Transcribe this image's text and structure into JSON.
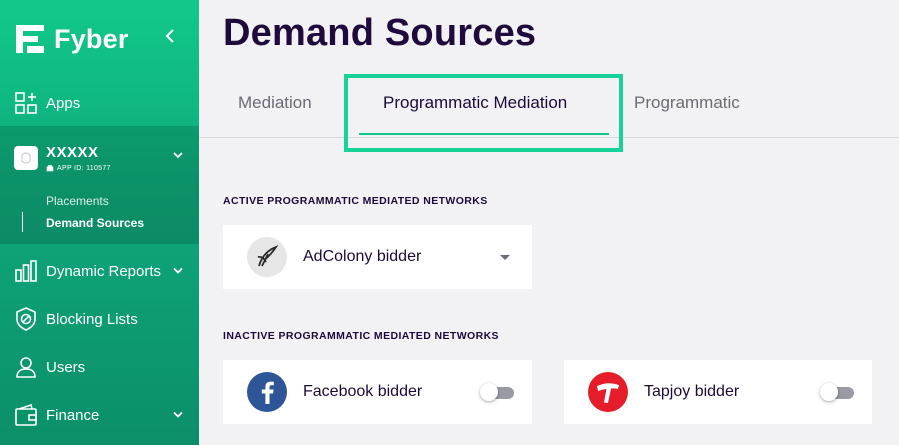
{
  "brand": {
    "name": "Fyber",
    "collapse_icon": "chevron-left-icon",
    "accent": "#10c98d",
    "sidebar_color": "#0fb37e"
  },
  "sidebar": {
    "apps_label": "Apps",
    "app": {
      "name": "XXXXX",
      "id_label": "APP ID: 110577",
      "platform_icon": "android-icon"
    },
    "sub_items": [
      {
        "label": "Placements",
        "active": false
      },
      {
        "label": "Demand Sources",
        "active": true
      }
    ],
    "items": [
      {
        "label": "Dynamic Reports",
        "icon": "bar-chart-icon",
        "has_chevron": true
      },
      {
        "label": "Blocking Lists",
        "icon": "shield-block-icon",
        "has_chevron": false
      },
      {
        "label": "Users",
        "icon": "user-icon",
        "has_chevron": false
      },
      {
        "label": "Finance",
        "icon": "wallet-icon",
        "has_chevron": true
      }
    ]
  },
  "page": {
    "title": "Demand Sources",
    "tabs": [
      {
        "label": "Mediation",
        "active": false
      },
      {
        "label": "Programmatic Mediation",
        "active": true
      },
      {
        "label": "Programmatic",
        "active": false
      }
    ]
  },
  "active_section": {
    "title": "ACTIVE PROGRAMMATIC MEDIATED NETWORKS",
    "networks": [
      {
        "name": "AdColony bidder",
        "icon": "adcolony-logo-icon"
      }
    ]
  },
  "inactive_section": {
    "title": "INACTIVE PROGRAMMATIC MEDIATED NETWORKS",
    "networks": [
      {
        "name": "Facebook bidder",
        "icon": "facebook-logo-icon",
        "enabled": false,
        "color": "#2d5597"
      },
      {
        "name": "Tapjoy bidder",
        "icon": "tapjoy-logo-icon",
        "enabled": false,
        "color": "#e51d2a"
      }
    ]
  }
}
